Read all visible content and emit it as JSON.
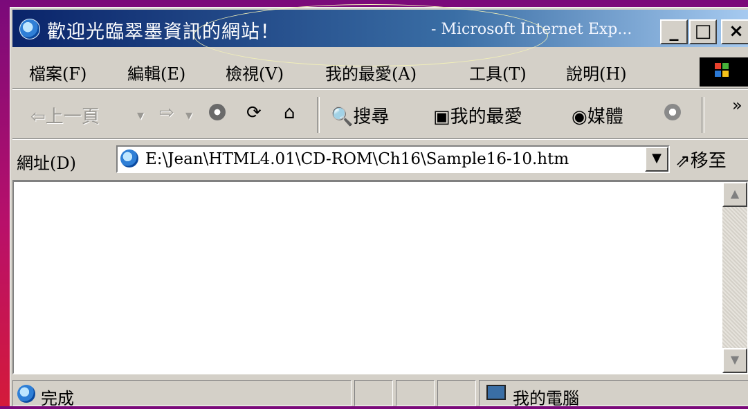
{
  "window": {
    "title_main": "歡迎光臨翠墨資訊的網站！",
    "title_sub": "- Microsoft Internet Exp...",
    "controls": {
      "minimize": "_",
      "maximize": "□",
      "close": "×"
    }
  },
  "menu": {
    "items": [
      {
        "label": "檔案(F)"
      },
      {
        "label": "編輯(E)"
      },
      {
        "label": "檢視(V)"
      },
      {
        "label": "我的最愛(A)"
      },
      {
        "label": "工具(T)"
      },
      {
        "label": "說明(H)"
      }
    ]
  },
  "toolbar": {
    "back": "上一頁",
    "search": "搜尋",
    "favorites": "我的最愛",
    "media": "媒體",
    "more": "»"
  },
  "address": {
    "label": "網址(D)",
    "value": "E:\\Jean\\HTML4.01\\CD-ROM\\Ch16\\Sample16-10.htm",
    "go_label": "移至"
  },
  "status": {
    "left_text": "完成",
    "zone_text": "我的電腦"
  },
  "colors": {
    "title_gradient_start": "#0a246a",
    "title_gradient_end": "#a6caf0",
    "chrome": "#d4d0c8"
  }
}
